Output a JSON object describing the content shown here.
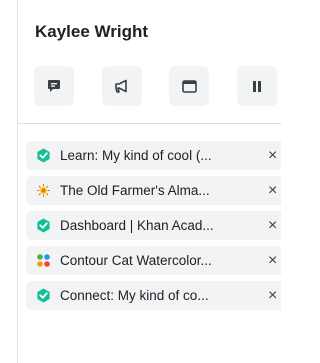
{
  "profile": {
    "name": "Kaylee Wright"
  },
  "actions": [
    {
      "icon": "message-icon"
    },
    {
      "icon": "megaphone-icon"
    },
    {
      "icon": "window-icon"
    },
    {
      "icon": "pause-icon"
    }
  ],
  "tabs": [
    {
      "title": "Learn: My kind of cool (...",
      "icon": "khan-academy-icon",
      "close": "×"
    },
    {
      "title": "The Old Farmer's Alma...",
      "icon": "farmers-almanac-icon",
      "close": "×"
    },
    {
      "title": "Dashboard | Khan Acad...",
      "icon": "khan-academy-icon",
      "close": "×"
    },
    {
      "title": "Contour Cat Watercolor...",
      "icon": "four-dots-icon",
      "close": "×"
    },
    {
      "title": "Connect: My kind of co...",
      "icon": "khan-academy-icon",
      "close": "×"
    }
  ],
  "colors": {
    "khan_green": "#14bf96",
    "button_bg": "#f1f3f4",
    "icon_dark": "#3c4043"
  }
}
